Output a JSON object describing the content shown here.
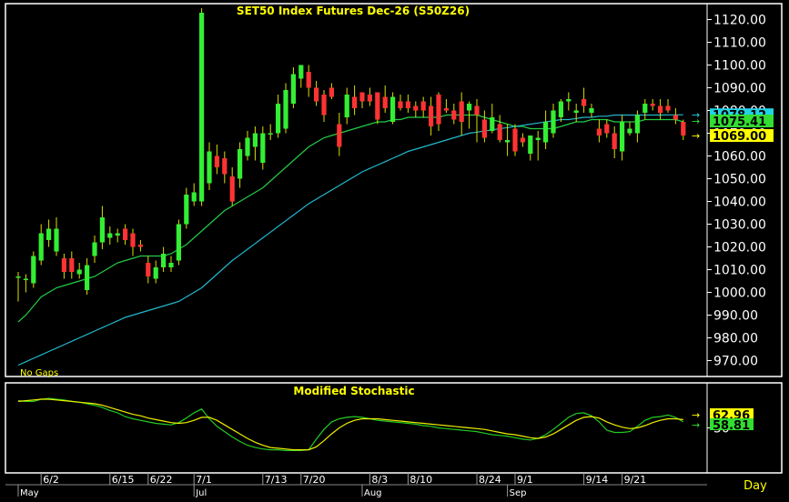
{
  "colors": {
    "background": "#000000",
    "frame": "#ffffff",
    "up_candle": "#33ee33",
    "down_candle": "#ff3333",
    "wick": "#dddd00",
    "ma_fast": "#22cc44",
    "ma_slow": "#22b8cc",
    "stoch_k": "#22cc22",
    "stoch_d": "#eeee00",
    "title_text": "#ffff00",
    "axis_text": "#ffffff"
  },
  "chart_data": [
    {
      "type": "candlestick",
      "title": "SET50  Index  Futures  Dec-26  (S50Z26)",
      "note": "No Gaps",
      "ylim": [
        963,
        1127
      ],
      "y_ticks": [
        "970.00",
        "980.00",
        "990.00",
        "1000.00",
        "1010.00",
        "1020.00",
        "1030.00",
        "1040.00",
        "1050.00",
        "1060.00",
        "1070.00",
        "1080.00",
        "1090.00",
        "1100.00",
        "1110.00",
        "1120.00"
      ],
      "price_tags": [
        {
          "label": "1078.12",
          "value": 1078.12,
          "color": "#22d3e6"
        },
        {
          "label": "1075.41",
          "value": 1075.41,
          "color": "#33dd33"
        },
        {
          "label": "1069.00",
          "value": 1069.0,
          "color": "#ffff00"
        }
      ],
      "x_ticks": [
        {
          "label": "6/2",
          "index": 3
        },
        {
          "label": "6/15",
          "index": 12
        },
        {
          "label": "6/22",
          "index": 17
        },
        {
          "label": "7/1",
          "index": 23
        },
        {
          "label": "7/13",
          "index": 32
        },
        {
          "label": "7/20",
          "index": 37
        },
        {
          "label": "8/3",
          "index": 46
        },
        {
          "label": "8/10",
          "index": 51
        },
        {
          "label": "8/24",
          "index": 60
        },
        {
          "label": "9/1",
          "index": 65
        },
        {
          "label": "9/14",
          "index": 74
        },
        {
          "label": "9/21",
          "index": 79
        }
      ],
      "month_labels": [
        {
          "label": "May",
          "index": 0
        },
        {
          "label": "Jul",
          "index": 23
        },
        {
          "label": "Aug",
          "index": 45
        },
        {
          "label": "Sep",
          "index": 64
        }
      ],
      "candles": [
        [
          1007,
          1007,
          1009,
          996
        ],
        [
          1006,
          1006,
          1008,
          1000
        ],
        [
          1004,
          1016,
          1018,
          1002
        ],
        [
          1014,
          1026,
          1030,
          1012
        ],
        [
          1023,
          1028,
          1032,
          1020
        ],
        [
          1018,
          1028,
          1033,
          1016
        ],
        [
          1015,
          1009,
          1017,
          1006
        ],
        [
          1015,
          1009,
          1018,
          1006
        ],
        [
          1008,
          1010,
          1013,
          1006
        ],
        [
          1001,
          1012,
          1015,
          999
        ],
        [
          1016,
          1022,
          1025,
          1013
        ],
        [
          1022,
          1033,
          1038,
          1019
        ],
        [
          1024,
          1026,
          1029,
          1021
        ],
        [
          1025,
          1026,
          1028,
          1022
        ],
        [
          1028,
          1023,
          1030,
          1021
        ],
        [
          1026,
          1020,
          1028,
          1016
        ],
        [
          1021,
          1020,
          1023,
          1018
        ],
        [
          1013,
          1007,
          1016,
          1004
        ],
        [
          1006,
          1011,
          1014,
          1004
        ],
        [
          1011,
          1017,
          1020,
          1009
        ],
        [
          1011,
          1013,
          1016,
          1009
        ],
        [
          1014,
          1030,
          1032,
          1012
        ],
        [
          1030,
          1043,
          1046,
          1028
        ],
        [
          1040,
          1044,
          1048,
          1038
        ],
        [
          1040,
          1123,
          1125,
          1038
        ],
        [
          1048,
          1062,
          1066,
          1045
        ],
        [
          1060,
          1055,
          1065,
          1052
        ],
        [
          1059,
          1052,
          1062,
          1048
        ],
        [
          1051,
          1040,
          1055,
          1038
        ],
        [
          1050,
          1063,
          1066,
          1046
        ],
        [
          1060,
          1068,
          1071,
          1058
        ],
        [
          1064,
          1070,
          1073,
          1058
        ],
        [
          1057,
          1070,
          1073,
          1054
        ],
        [
          1070,
          1070,
          1074,
          1067
        ],
        [
          1070,
          1083,
          1087,
          1068
        ],
        [
          1072,
          1089,
          1092,
          1070
        ],
        [
          1083,
          1096,
          1099,
          1081
        ],
        [
          1094,
          1100,
          1100,
          1090
        ],
        [
          1097,
          1090,
          1100,
          1086
        ],
        [
          1090,
          1084,
          1093,
          1082
        ],
        [
          1087,
          1078,
          1089,
          1075
        ],
        [
          1090,
          1086,
          1092,
          1085
        ],
        [
          1074,
          1064,
          1079,
          1060
        ],
        [
          1077,
          1087,
          1090,
          1074
        ],
        [
          1086,
          1081,
          1091,
          1078
        ],
        [
          1088,
          1084,
          1088,
          1081
        ],
        [
          1087,
          1084,
          1090,
          1082
        ],
        [
          1088,
          1076,
          1088,
          1074
        ],
        [
          1086,
          1081,
          1091,
          1079
        ],
        [
          1075,
          1086,
          1088,
          1074
        ],
        [
          1084,
          1081,
          1087,
          1080
        ],
        [
          1084,
          1081,
          1087,
          1079
        ],
        [
          1082,
          1080,
          1084,
          1077
        ],
        [
          1084,
          1080,
          1086,
          1077
        ],
        [
          1082,
          1073,
          1086,
          1069
        ],
        [
          1087,
          1074,
          1088,
          1071
        ],
        [
          1081,
          1080,
          1085,
          1079
        ],
        [
          1080,
          1076,
          1083,
          1074
        ],
        [
          1084,
          1075,
          1088,
          1069
        ],
        [
          1080,
          1083,
          1084,
          1072
        ],
        [
          1082,
          1078,
          1085,
          1066
        ],
        [
          1076,
          1068,
          1080,
          1066
        ],
        [
          1071,
          1077,
          1083,
          1070
        ],
        [
          1074,
          1067,
          1078,
          1066
        ],
        [
          1066,
          1067,
          1074,
          1060
        ],
        [
          1072,
          1062,
          1074,
          1060
        ],
        [
          1068,
          1066,
          1070,
          1064
        ],
        [
          1061,
          1069,
          1069,
          1058
        ],
        [
          1067,
          1068,
          1071,
          1058
        ],
        [
          1066,
          1075,
          1080,
          1063
        ],
        [
          1070,
          1080,
          1083,
          1068
        ],
        [
          1077,
          1084,
          1085,
          1075
        ],
        [
          1084,
          1085,
          1088,
          1080
        ],
        [
          1079,
          1080,
          1083,
          1075
        ],
        [
          1085,
          1082,
          1090,
          1079
        ],
        [
          1079,
          1081,
          1083,
          1077
        ],
        [
          1072,
          1069,
          1076,
          1066
        ],
        [
          1074,
          1070,
          1076,
          1068
        ],
        [
          1070,
          1063,
          1073,
          1059
        ],
        [
          1062,
          1075,
          1078,
          1058
        ],
        [
          1070,
          1072,
          1075,
          1069
        ],
        [
          1070,
          1078,
          1080,
          1066
        ],
        [
          1079,
          1083,
          1085,
          1076
        ],
        [
          1083,
          1082,
          1085,
          1080
        ],
        [
          1082,
          1079,
          1085,
          1076
        ],
        [
          1082,
          1080,
          1085,
          1079
        ],
        [
          1078,
          1076,
          1081,
          1074
        ],
        [
          1075,
          1069,
          1076,
          1067
        ]
      ],
      "series": [
        {
          "kind": "ma_fast",
          "values": [
            987,
            990,
            994,
            998,
            1000,
            1002,
            1003,
            1004,
            1005,
            1006,
            1007,
            1009,
            1011,
            1013,
            1014,
            1015,
            1016,
            1016,
            1016,
            1016,
            1017,
            1019,
            1021,
            1024,
            1027,
            1030,
            1033,
            1036,
            1038,
            1040,
            1042,
            1044,
            1046,
            1049,
            1052,
            1055,
            1058,
            1061,
            1064,
            1066,
            1068,
            1069,
            1070,
            1071,
            1072,
            1073,
            1074,
            1075,
            1075,
            1076,
            1076,
            1077,
            1077,
            1077,
            1077,
            1077,
            1078,
            1078,
            1078,
            1078,
            1078,
            1077,
            1076,
            1075,
            1074,
            1073,
            1073,
            1072,
            1072,
            1072,
            1072,
            1073,
            1074,
            1075,
            1075,
            1076,
            1076,
            1076,
            1075,
            1075,
            1075,
            1075,
            1076,
            1076,
            1076,
            1076,
            1076,
            1075
          ]
        },
        {
          "kind": "ma_slow",
          "values": [
            968,
            969.5,
            971,
            972.5,
            974,
            975.5,
            977,
            978.5,
            980,
            981.5,
            983,
            984.5,
            986,
            987.5,
            989,
            990,
            991,
            992,
            993,
            994,
            995,
            996,
            998,
            1000,
            1002,
            1005,
            1008,
            1011,
            1014,
            1016.5,
            1019,
            1021.5,
            1024,
            1026.5,
            1029,
            1031.5,
            1034,
            1036.5,
            1039,
            1041,
            1043,
            1045,
            1047,
            1049,
            1051,
            1053,
            1054.5,
            1056,
            1057.5,
            1059,
            1060.5,
            1062,
            1063,
            1064,
            1065,
            1066,
            1067,
            1068,
            1069,
            1070,
            1070.5,
            1071,
            1071.5,
            1072,
            1072.5,
            1073,
            1073.5,
            1074,
            1074.5,
            1075,
            1075.5,
            1076,
            1076,
            1076.5,
            1077,
            1077,
            1077.5,
            1077.5,
            1078,
            1078,
            1078,
            1078,
            1078,
            1078,
            1078,
            1078.1,
            1078.1,
            1078.12
          ]
        }
      ]
    },
    {
      "type": "line",
      "title": "Modified  Stochastic",
      "ylim": [
        0,
        100
      ],
      "y_ticks": [
        "50"
      ],
      "value_tags": [
        {
          "label": "62.96",
          "value": 62.96,
          "color": "#ffff00"
        },
        {
          "label": "58.81",
          "value": 58.81,
          "color": "#33dd33"
        }
      ],
      "timeframe": "Day",
      "series": [
        {
          "kind": "k",
          "values": [
            86,
            85,
            85,
            88,
            89,
            88,
            87,
            85,
            84,
            82,
            80,
            77,
            73,
            70,
            65,
            62,
            60,
            58,
            56,
            55,
            54,
            57,
            63,
            70,
            75,
            62,
            52,
            45,
            38,
            32,
            27,
            24,
            22,
            21,
            21,
            20,
            20,
            20,
            21,
            35,
            48,
            58,
            62,
            64,
            65,
            64,
            62,
            60,
            59,
            58,
            57,
            56,
            55,
            53,
            52,
            50,
            49,
            48,
            47,
            46,
            45,
            43,
            41,
            40,
            39,
            37,
            35,
            34,
            36,
            41,
            48,
            56,
            64,
            69,
            70,
            66,
            58,
            47,
            44,
            44,
            45,
            52,
            60,
            64,
            65,
            67,
            64,
            58
          ]
        },
        {
          "kind": "d",
          "values": [
            85,
            86,
            87,
            88,
            88,
            87,
            86,
            85,
            84,
            83,
            82,
            80,
            77,
            74,
            71,
            68,
            66,
            63,
            61,
            59,
            57,
            56,
            57,
            60,
            64,
            64,
            60,
            54,
            48,
            42,
            36,
            31,
            27,
            24,
            23,
            22,
            21,
            21,
            21,
            25,
            33,
            42,
            50,
            56,
            60,
            62,
            62,
            62,
            61,
            60,
            59,
            58,
            57,
            56,
            55,
            54,
            53,
            52,
            51,
            50,
            49,
            48,
            46,
            44,
            42,
            41,
            39,
            37,
            36,
            38,
            42,
            48,
            54,
            60,
            64,
            65,
            63,
            58,
            54,
            51,
            49,
            50,
            53,
            57,
            60,
            62,
            62,
            61
          ]
        }
      ]
    }
  ]
}
